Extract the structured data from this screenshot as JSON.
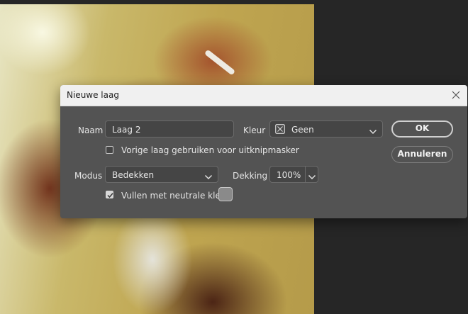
{
  "dialog": {
    "title": "Nieuwe laag",
    "name_label": "Naam",
    "name_value": "Laag 2",
    "color_label": "Kleur",
    "color_value": "Geen",
    "clipping_mask_label": "Vorige laag gebruiken voor uitknipmasker",
    "clipping_mask_checked": false,
    "mode_label": "Modus",
    "mode_value": "Bedekken",
    "opacity_label": "Dekking",
    "opacity_value": "100%",
    "fill_neutral_label": "Vullen met neutrale kleur",
    "fill_neutral_checked": true,
    "ok_label": "OK",
    "cancel_label": "Annuleren"
  },
  "colors": {
    "dialog_bg": "#535353",
    "titlebar_bg": "#f0f0f0",
    "neutral_swatch": "#8a8a8a"
  }
}
